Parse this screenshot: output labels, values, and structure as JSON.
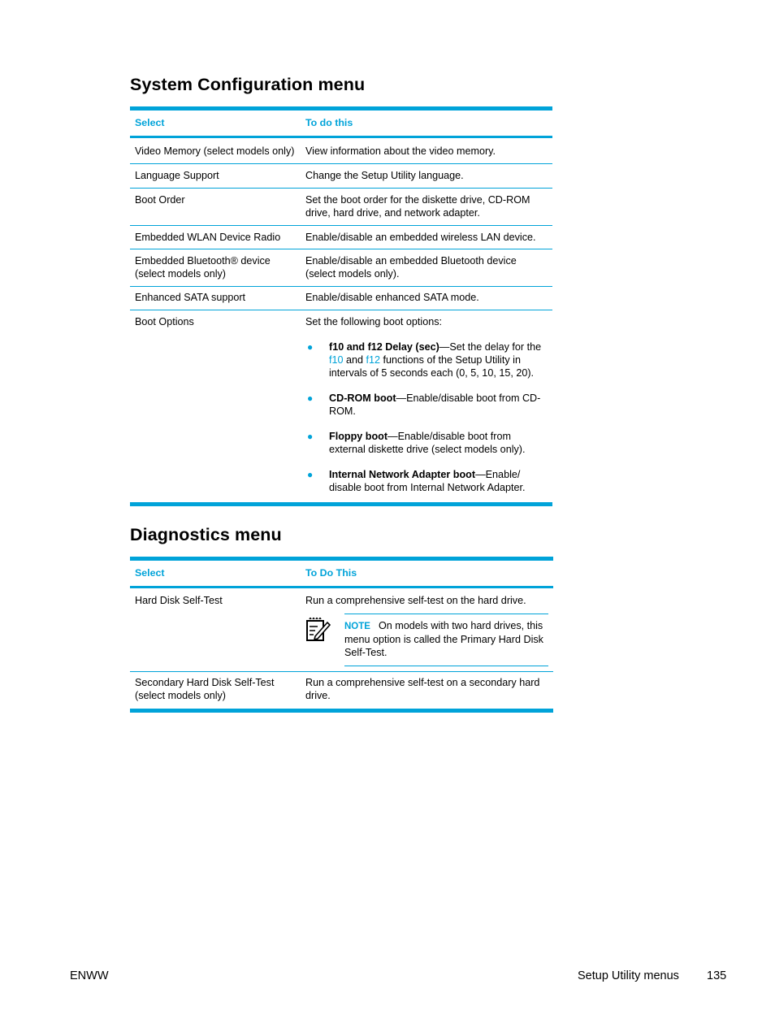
{
  "sections": {
    "system_config": {
      "title": "System Configuration menu",
      "headers": [
        "Select",
        "To do this"
      ],
      "rows": [
        {
          "select": "Video Memory (select models only)",
          "action": "View information about the video memory."
        },
        {
          "select": "Language Support",
          "action": "Change the Setup Utility language."
        },
        {
          "select": "Boot Order",
          "action": "Set the boot order for the diskette drive, CD-ROM drive, hard drive, and network adapter."
        },
        {
          "select": "Embedded WLAN Device Radio",
          "action": "Enable/disable an embedded wireless LAN device."
        },
        {
          "select": "Embedded Bluetooth® device (select models only)",
          "action": "Enable/disable an embedded Bluetooth device (select models only)."
        },
        {
          "select": "Enhanced SATA support",
          "action": "Enable/disable enhanced SATA mode."
        }
      ],
      "boot_options": {
        "select": "Boot Options",
        "intro": "Set the following boot options:",
        "items": [
          {
            "term": "f10 and f12 Delay (sec)",
            "text_a": "—Set the delay for the ",
            "key1": "f10",
            "text_b": " and ",
            "key2": "f12",
            "text_c": " functions of the Setup Utility in intervals of 5 seconds each (0, 5, 10, 15, 20)."
          },
          {
            "term": "CD-ROM boot",
            "text": "—Enable/disable boot from CD-ROM."
          },
          {
            "term": "Floppy boot",
            "text": "—Enable/disable boot from external diskette drive (select models only)."
          },
          {
            "term": "Internal Network Adapter boot",
            "text": "—Enable/ disable boot from Internal Network Adapter."
          }
        ]
      }
    },
    "diagnostics": {
      "title": "Diagnostics menu",
      "headers": [
        "Select",
        "To Do This"
      ],
      "rows": [
        {
          "select": "Hard Disk Self-Test",
          "action": "Run a comprehensive self-test on the hard drive.",
          "note_label": "NOTE",
          "note_text": "On models with two hard drives, this menu option is called the Primary Hard Disk Self-Test."
        },
        {
          "select": "Secondary Hard Disk Self-Test (select models only)",
          "action": "Run a comprehensive self-test on a secondary hard drive."
        }
      ]
    }
  },
  "footer": {
    "left": "ENWW",
    "chapter": "Setup Utility menus",
    "page_number": "135"
  },
  "colors": {
    "accent": "#00a3d9",
    "text": "#000000"
  }
}
